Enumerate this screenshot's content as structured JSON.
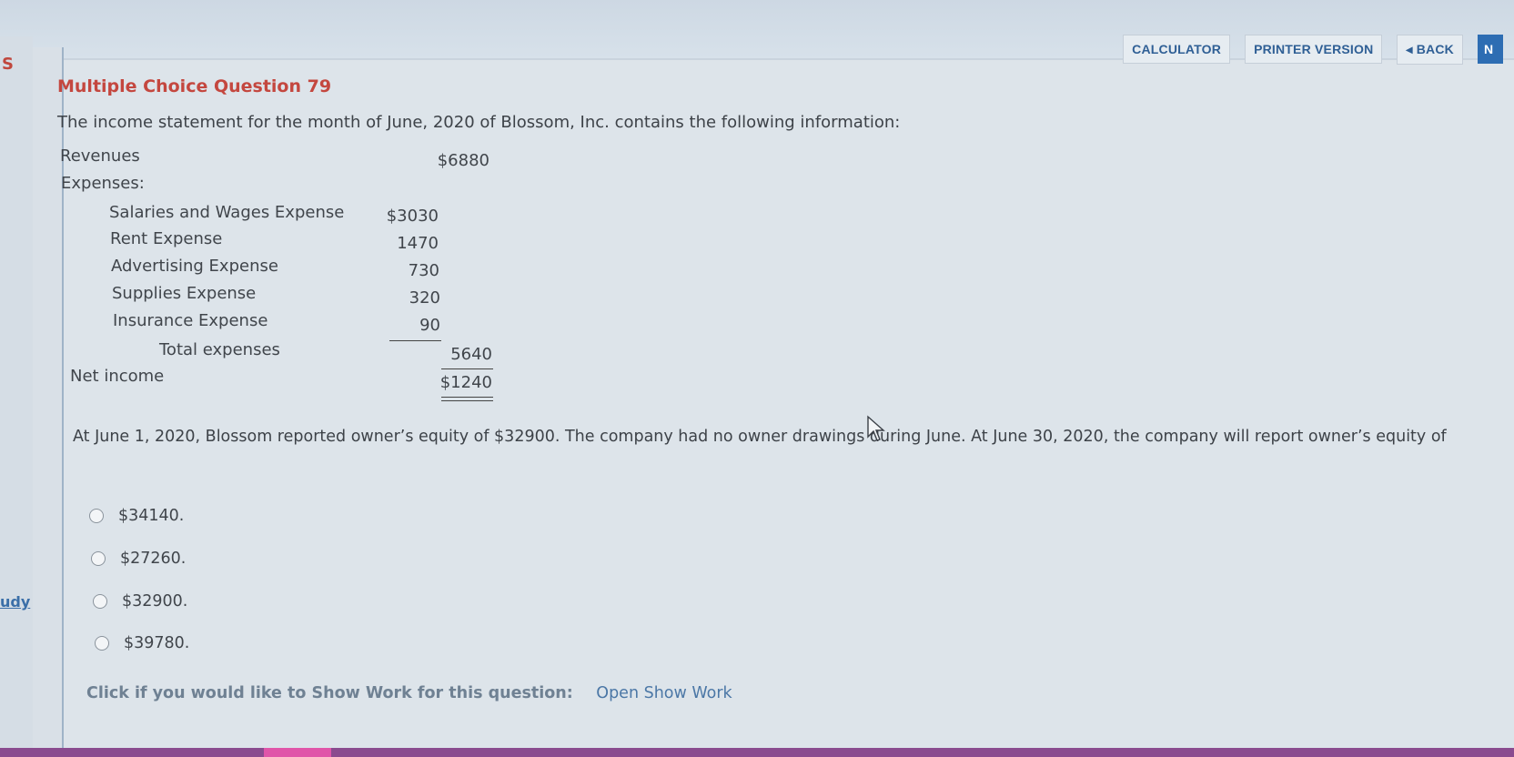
{
  "toolbar": {
    "calculator": "CALCULATOR",
    "printer_version": "PRINTER VERSION",
    "back": "BACK",
    "next": "N"
  },
  "left_edge": {
    "s": "S",
    "study": "udy"
  },
  "question": {
    "title": "Multiple Choice Question 79",
    "intro": "The income statement for the month of June, 2020 of Blossom, Inc. contains the following information:"
  },
  "statement": {
    "revenues_label": "Revenues",
    "revenues_value": "$6880",
    "expenses_label": "Expenses:",
    "expenses": [
      {
        "label": "Salaries and Wages Expense",
        "value": "$3030"
      },
      {
        "label": "Rent Expense",
        "value": "1470"
      },
      {
        "label": "Advertising Expense",
        "value": "730"
      },
      {
        "label": "Supplies Expense",
        "value": "320"
      },
      {
        "label": "Insurance Expense",
        "value": "90"
      }
    ],
    "total_label": "Total expenses",
    "total_value": "5640",
    "net_label": "Net income",
    "net_value": "$1240"
  },
  "paragraph": "At June 1, 2020, Blossom reported owner’s equity of $32900. The company had no owner drawings during June. At June 30, 2020, the company will report owner’s equity of",
  "options": [
    "$34140.",
    "$27260.",
    "$32900.",
    "$39780."
  ],
  "show_work": {
    "label": "Click if you would like to Show Work for this question:",
    "link": "Open Show Work"
  },
  "colors": {
    "title_red": "#c4473f",
    "link_blue": "#2f5f95",
    "background": "#dde4ea"
  }
}
